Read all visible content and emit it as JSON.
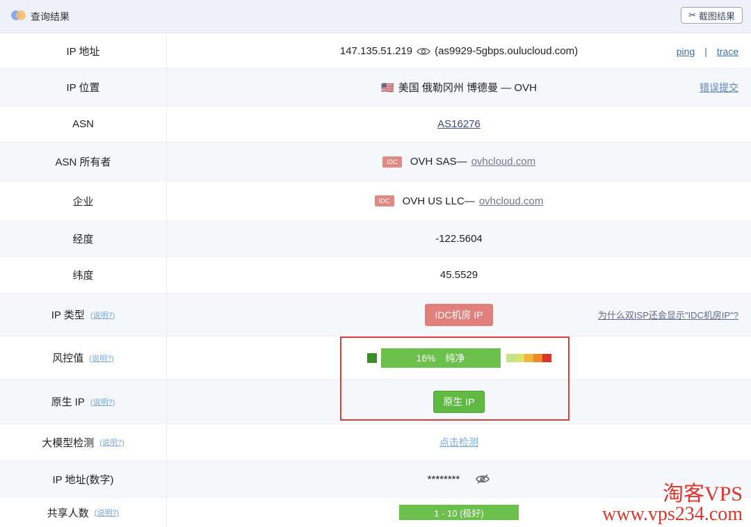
{
  "header": {
    "title": "查询结果",
    "screenshot_label": "截图结果"
  },
  "rows": {
    "ip": {
      "label": "IP 地址",
      "value": "147.135.51.219",
      "host": "(as9929-5gbps.oulucloud.com)",
      "ping": "ping",
      "sep": "|",
      "trace": "trace"
    },
    "location": {
      "label": "IP 位置",
      "flag": "🇺🇸",
      "value": "美国 俄勒冈州 博德曼 — OVH",
      "report": "错误提交"
    },
    "asn": {
      "label": "ASN",
      "value": "AS16276"
    },
    "asn_owner": {
      "label": "ASN 所有者",
      "tag": "IDC",
      "name": "OVH SAS—",
      "domain": "ovhcloud.com"
    },
    "company": {
      "label": "企业",
      "tag": "IDC",
      "name": "OVH US LLC—",
      "domain": "ovhcloud.com"
    },
    "longitude": {
      "label": "经度",
      "value": "-122.5604"
    },
    "latitude": {
      "label": "纬度",
      "value": "45.5529"
    },
    "ip_type": {
      "label": "IP 类型",
      "help": "(说明?)",
      "value": "IDC机房 IP",
      "question": "为什么双ISP还会显示\"IDC机房IP\"?"
    },
    "risk": {
      "label": "风控值",
      "help": "(说明?)",
      "percent": "16%",
      "text": "纯净",
      "level": 0.16
    },
    "native": {
      "label": "原生 IP",
      "help": "(说明?)",
      "value": "原生 IP"
    },
    "llm": {
      "label": "大模型检测",
      "help": "(说明?)",
      "value": "点击检测"
    },
    "ip_numeric": {
      "label": "IP 地址(数字)",
      "value": "********"
    },
    "sharing": {
      "label": "共享人数",
      "help": "(说明?)",
      "value": "1 - 10 (极好)"
    }
  },
  "colors": {
    "risk_scale": [
      "#c7e08a",
      "#d9e26a",
      "#f0b43c",
      "#ec8a2a",
      "#d9352b"
    ]
  },
  "watermark": {
    "line1": "淘客VPS",
    "line2": "www.vps234.com"
  }
}
